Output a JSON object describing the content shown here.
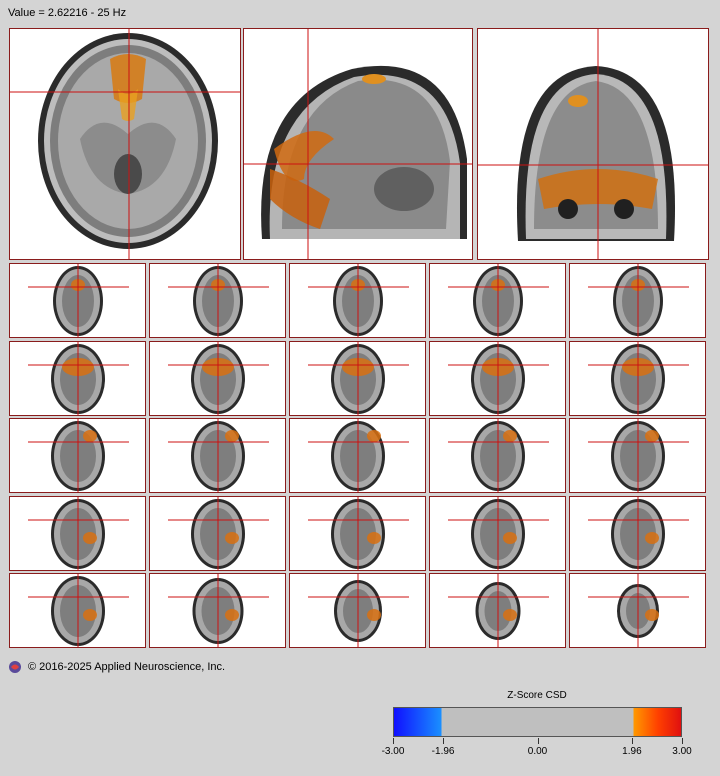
{
  "header": {
    "value_readout": "Value = 2.62216 - 25 Hz"
  },
  "footer": {
    "copyright": "© 2016-2025 Applied Neuroscience, Inc.",
    "logo_icon": "brain-logo-icon"
  },
  "colorbar": {
    "title": "Z-Score CSD",
    "ticks": [
      "-3.00",
      "-1.96",
      "0.00",
      "1.96",
      "3.00"
    ],
    "colors": {
      "neg_low": "#1010ff",
      "neg_high": "#1a90ff",
      "neutral": "#bfbfbf",
      "pos_low": "#ff9a00",
      "pos_high": "#e01010"
    }
  },
  "views": {
    "main": [
      "axial",
      "sagittal",
      "coronal"
    ],
    "grid_rows": 5,
    "grid_cols": 5
  },
  "colors": {
    "crosshair": "#cc1111",
    "panel_border": "#8a1c1c",
    "background": "#d4d4d4"
  }
}
